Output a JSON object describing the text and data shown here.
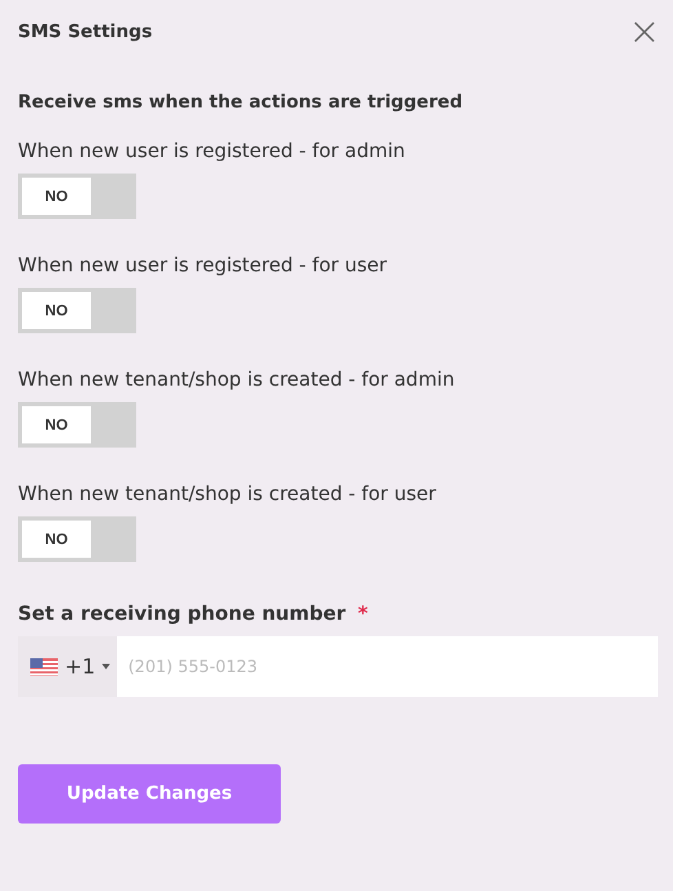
{
  "dialog": {
    "title": "SMS Settings",
    "close": "×"
  },
  "section_heading": "Receive sms when the actions are triggered",
  "settings": [
    {
      "label": "When new user is registered - for admin",
      "on": false,
      "state_text": "NO"
    },
    {
      "label": "When new user is registered - for user",
      "on": false,
      "state_text": "NO"
    },
    {
      "label": "When new tenant/shop is created - for admin",
      "on": false,
      "state_text": "NO"
    },
    {
      "label": "When new tenant/shop is created - for user",
      "on": false,
      "state_text": "NO"
    }
  ],
  "phone": {
    "label": "Set a receiving phone number",
    "required": true,
    "required_mark": "*",
    "country_code": "+1",
    "placeholder": "(201) 555-0123"
  },
  "buttons": [
    {
      "label": "Update Changes"
    }
  ]
}
